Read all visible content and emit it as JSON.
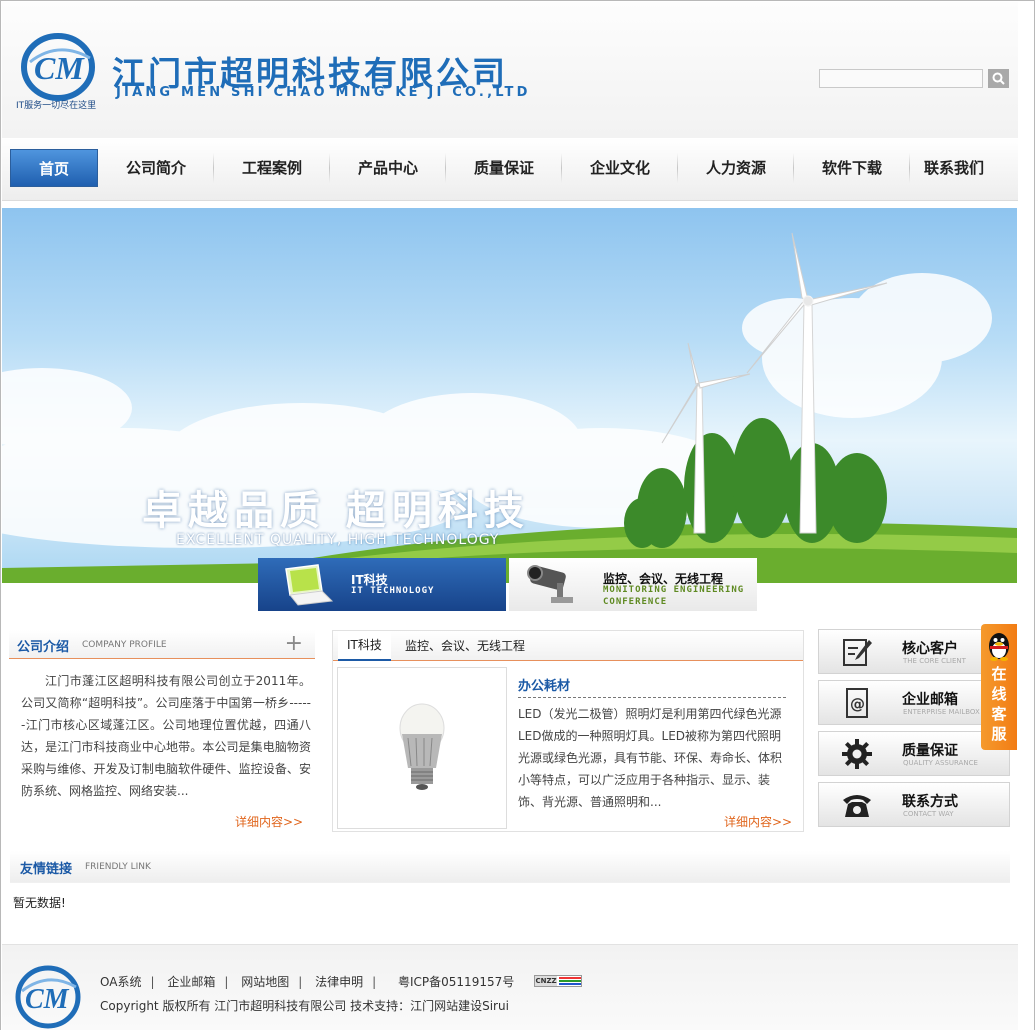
{
  "header": {
    "company_cn": "江门市超明科技有限公司",
    "company_en": "JIANG MEN SHI CHAO MING KE JI CO.,LTD",
    "slogan": "IT服务一切尽在这里",
    "search_placeholder": ""
  },
  "nav": {
    "items": [
      "首页",
      "公司简介",
      "工程案例",
      "产品中心",
      "质量保证",
      "企业文化",
      "人力资源",
      "软件下载",
      "联系我们"
    ]
  },
  "banner": {
    "title_cn": "卓越品质  超明科技",
    "title_en": "EXCELLENT QUALITY, HIGH TECHNOLOGY",
    "tabs": [
      {
        "cn": "IT科技",
        "en": "IT TECHNOLOGY"
      },
      {
        "cn": "监控、会议、无线工程",
        "en": "MONITORING ENGINEERING CONFERENCE"
      }
    ]
  },
  "profile": {
    "title": "公司介绍",
    "title_en": "COMPANY PROFILE",
    "plus": "+",
    "text": "江门市蓬江区超明科技有限公司创立于2011年。公司又简称“超明科技”。公司座落于中国第一桥乡------江门市核心区域蓬江区。公司地理位置优越，四通八达，是江门市科技商业中心地带。本公司是集电脑物资采购与维修、开发及订制电脑软件硬件、监控设备、安防系统、网格监控、网络安装...",
    "more": "详细内容>>"
  },
  "product": {
    "tabs": [
      "IT科技",
      "监控、会议、无线工程"
    ],
    "item_title": "办公耗材",
    "item_desc": "LED（发光二极管）照明灯是利用第四代绿色光源LED做成的一种照明灯具。LED被称为第四代照明光源或绿色光源，具有节能、环保、寿命长、体积小等特点，可以广泛应用于各种指示、显示、装饰、背光源、普通照明和...",
    "more": "详细内容>>"
  },
  "quick_links": [
    {
      "cn": "核心客户",
      "en": "THE CORE CLIENT",
      "icon": "edit-icon"
    },
    {
      "cn": "企业邮箱",
      "en": "ENTERPRISE MAILBOX",
      "icon": "mail-icon"
    },
    {
      "cn": "质量保证",
      "en": "QUALITY ASSURANCE",
      "icon": "gear-icon"
    },
    {
      "cn": "联系方式",
      "en": "CONTACT WAY",
      "icon": "phone-icon"
    }
  ],
  "kefu": {
    "label": "在线客服"
  },
  "friend_links": {
    "title": "友情链接",
    "title_en": "FRIENDLY LINK",
    "empty": "暂无数据!"
  },
  "footer": {
    "links": [
      "OA系统",
      "企业邮箱",
      "网站地图",
      "法律申明"
    ],
    "icp": "粤ICP备05119157号",
    "cnzz": "CNZZ",
    "copyright": "Copyright 版权所有 江门市超明科技有限公司  技术支持：江门网站建设Sirui"
  },
  "colors": {
    "brand_blue": "#1c5aa6",
    "accent_orange": "#e0651c",
    "kefu_orange": "#f27c14"
  }
}
